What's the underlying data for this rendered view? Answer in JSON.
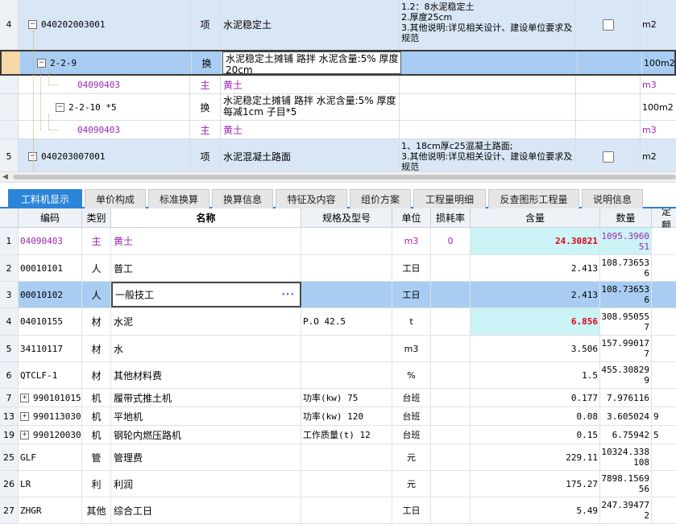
{
  "top_rows": [
    {
      "idx": "4",
      "code": "040202003001",
      "type": "项",
      "name": "水泥稳定土",
      "features": "1.2：8水泥稳定土\n2.厚度25cm\n3.其他说明:详见相关设计、建设单位要求及规范",
      "unit": "m2"
    },
    {
      "idx": "",
      "code": "2-2-9",
      "type": "换",
      "name": "水泥稳定土摊铺 路拌 水泥含量:5% 厚度20cm",
      "features": "",
      "unit": "100m2"
    },
    {
      "idx": "",
      "code": "04090403",
      "type": "主",
      "name": "黄土",
      "features": "",
      "unit": "m3"
    },
    {
      "idx": "",
      "code": "2-2-10 *5",
      "type": "换",
      "name": "水泥稳定土摊铺 路拌 水泥含量:5% 厚度每减1cm   子目*5",
      "features": "",
      "unit": "100m2"
    },
    {
      "idx": "",
      "code": "04090403",
      "type": "主",
      "name": "黄土",
      "features": "",
      "unit": "m3"
    },
    {
      "idx": "5",
      "code": "040203007001",
      "type": "项",
      "name": "水泥混凝土路面",
      "features": "1、18cm厚c25混凝土路面;\n3.其他说明:详见相关设计、建设单位要求及规范",
      "unit": "m2"
    }
  ],
  "tabs": [
    "工料机显示",
    "单价构成",
    "标准换算",
    "换算信息",
    "特征及内容",
    "组价方案",
    "工程量明细",
    "反查图形工程量",
    "说明信息"
  ],
  "headers": {
    "code": "编码",
    "type": "类别",
    "name": "名称",
    "spec": "规格及型号",
    "unit": "单位",
    "loss": "损耗率",
    "qty": "含量",
    "num": "数量",
    "more": "定额"
  },
  "rows": [
    {
      "idx": "1",
      "code": "04090403",
      "type": "主",
      "name": "黄土",
      "spec": "",
      "unit": "m3",
      "loss": "0",
      "qty": "24.30821",
      "num": "1095.3960\n51",
      "more": ""
    },
    {
      "idx": "2",
      "code": "00010101",
      "type": "人",
      "name": "普工",
      "spec": "",
      "unit": "工日",
      "loss": "",
      "qty": "2.413",
      "num": "108.73653\n6",
      "more": ""
    },
    {
      "idx": "3",
      "code": "00010102",
      "type": "人",
      "name": "一般技工",
      "spec": "",
      "unit": "工日",
      "loss": "",
      "qty": "2.413",
      "num": "108.73653\n6",
      "more": ""
    },
    {
      "idx": "4",
      "code": "04010155",
      "type": "材",
      "name": "水泥",
      "spec": "P.O 42.5",
      "unit": "t",
      "loss": "",
      "qty": "6.856",
      "num": "308.95055\n7",
      "more": ""
    },
    {
      "idx": "5",
      "code": "34110117",
      "type": "材",
      "name": "水",
      "spec": "",
      "unit": "m3",
      "loss": "",
      "qty": "3.506",
      "num": "157.99017\n7",
      "more": ""
    },
    {
      "idx": "6",
      "code": "QTCLF-1",
      "type": "材",
      "name": "其他材料费",
      "spec": "",
      "unit": "%",
      "loss": "",
      "qty": "1.5",
      "num": "455.30829\n9",
      "more": ""
    },
    {
      "idx": "7",
      "code": "990101015",
      "type": "机",
      "name": "履带式推土机",
      "spec": "功率(kw) 75",
      "unit": "台班",
      "loss": "",
      "qty": "0.177",
      "num": "7.976116",
      "more": ""
    },
    {
      "idx": "13",
      "code": "990113030",
      "type": "机",
      "name": "平地机",
      "spec": "功率(kw) 120",
      "unit": "台班",
      "loss": "",
      "qty": "0.08",
      "num": "3.605024",
      "more": "9"
    },
    {
      "idx": "19",
      "code": "990120030",
      "type": "机",
      "name": "钢轮内燃压路机",
      "spec": "工作质量(t) 12",
      "unit": "台班",
      "loss": "",
      "qty": "0.15",
      "num": "6.75942",
      "more": "5"
    },
    {
      "idx": "25",
      "code": "GLF",
      "type": "管",
      "name": "管理费",
      "spec": "",
      "unit": "元",
      "loss": "",
      "qty": "229.11",
      "num": "10324.338\n108",
      "more": ""
    },
    {
      "idx": "26",
      "code": "LR",
      "type": "利",
      "name": "利润",
      "spec": "",
      "unit": "元",
      "loss": "",
      "qty": "175.27",
      "num": "7898.1569\n56",
      "more": ""
    },
    {
      "idx": "27",
      "code": "ZHGR",
      "type": "其他",
      "name": "综合工日",
      "spec": "",
      "unit": "工日",
      "loss": "",
      "qty": "5.49",
      "num": "247.39477\n2",
      "more": ""
    }
  ],
  "colors": {
    "accent": "#2b84d8",
    "selected": "#a9cdf2",
    "item_row": "#d9e6f5",
    "highlight": "#ccf3f5",
    "red": "#e0001b",
    "purple": "#9b26b0"
  }
}
